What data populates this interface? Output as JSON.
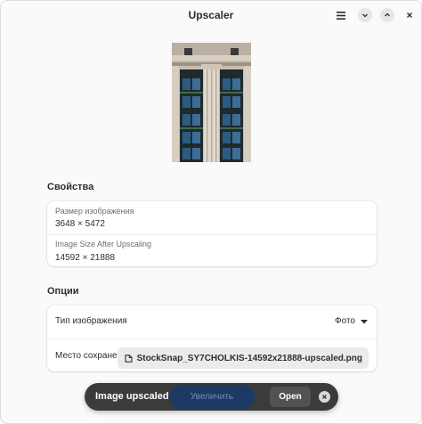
{
  "app": {
    "title": "Upscaler"
  },
  "header_icons": {
    "menu": "hamburger-menu-icon",
    "minimize": "chevron-down-icon",
    "maximize": "chevron-up-icon",
    "close": "close-icon"
  },
  "properties": {
    "section_title": "Свойства",
    "image_size_label": "Размер изображения",
    "image_size_value": "3648 × 5472",
    "size_after_label": "Image Size After Upscaling",
    "size_after_value": "14592 × 21888"
  },
  "options": {
    "section_title": "Опции",
    "image_type_label": "Тип изображения",
    "image_type_value": "Фото",
    "save_location_label": "Место сохранения",
    "save_location_file": "StockSnap_SY7CHOLKIS-14592x21888-upscaled.png"
  },
  "toast": {
    "message": "Image upscaled",
    "upscale_button": "Увеличить",
    "open_button": "Open"
  },
  "colors": {
    "accent_button_bg": "#1c3a63",
    "toast_bg": "#3b3b3b",
    "window_bg": "#fafafa"
  }
}
